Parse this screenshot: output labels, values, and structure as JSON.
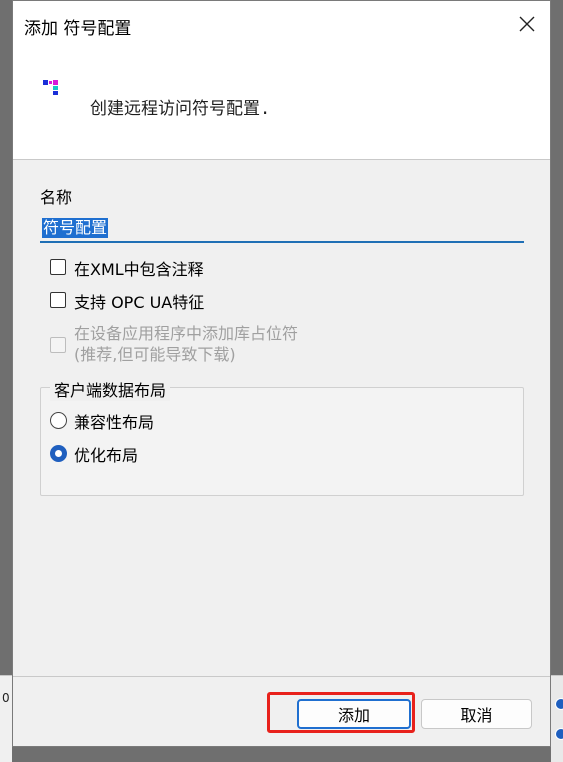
{
  "dialog": {
    "title": "添加 符号配置",
    "header_text": "创建远程访问符号配置.",
    "name_label": "名称",
    "name_value": "符号配置",
    "checkboxes": [
      {
        "label": "在XML中包含注释",
        "checked": false,
        "enabled": true
      },
      {
        "label": "支持 OPC UA特征",
        "checked": false,
        "enabled": true
      },
      {
        "label_line1": "在设备应用程序中添加库占位符",
        "label_line2": "(推荐,但可能导致下载)",
        "checked": false,
        "enabled": false
      }
    ],
    "layout_group": {
      "title": "客户端数据布局",
      "options": [
        {
          "label": "兼容性布局",
          "selected": false
        },
        {
          "label": "优化布局",
          "selected": true
        }
      ]
    },
    "buttons": {
      "add": "添加",
      "cancel": "取消"
    }
  },
  "background": {
    "left_fragment_text": "0"
  },
  "colors": {
    "accent": "#1f6fd0",
    "highlight": "#e8211b",
    "dialog_bg": "#f0f0f0"
  },
  "icons": [
    "close-icon",
    "symbol-config-icon"
  ]
}
